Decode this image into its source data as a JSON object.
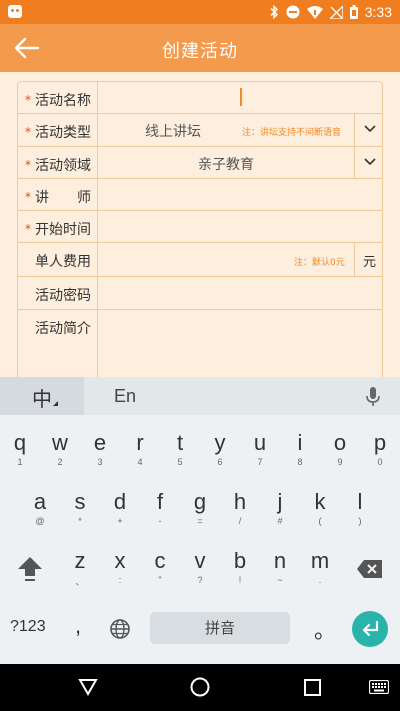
{
  "status_bar": {
    "time": "3:33"
  },
  "app_bar": {
    "title": "创建活动"
  },
  "form": {
    "required_mark": "*",
    "activity_name": {
      "label": "活动名称"
    },
    "activity_type": {
      "label": "活动类型",
      "value": "线上讲坛",
      "note": "注：讲坛支持不间断语音"
    },
    "activity_field": {
      "label": "活动领域",
      "value": "亲子教育"
    },
    "lecturer": {
      "label": "讲师"
    },
    "start_time": {
      "label": "开始时间"
    },
    "fee_per_person": {
      "label": "单人费用",
      "note": "注：默认0元",
      "unit": "元"
    },
    "activity_password": {
      "label": "活动密码"
    },
    "activity_intro": {
      "label": "活动简介"
    }
  },
  "keyboard": {
    "mode_zh": "中",
    "mode_en": "En",
    "row1": [
      {
        "k": "q",
        "s": "1"
      },
      {
        "k": "w",
        "s": "2"
      },
      {
        "k": "e",
        "s": "3"
      },
      {
        "k": "r",
        "s": "4"
      },
      {
        "k": "t",
        "s": "5"
      },
      {
        "k": "y",
        "s": "6"
      },
      {
        "k": "u",
        "s": "7"
      },
      {
        "k": "i",
        "s": "8"
      },
      {
        "k": "o",
        "s": "9"
      },
      {
        "k": "p",
        "s": "0"
      }
    ],
    "row2": [
      {
        "k": "a",
        "s": "@"
      },
      {
        "k": "s",
        "s": "*"
      },
      {
        "k": "d",
        "s": "+"
      },
      {
        "k": "f",
        "s": "-"
      },
      {
        "k": "g",
        "s": "="
      },
      {
        "k": "h",
        "s": "/"
      },
      {
        "k": "j",
        "s": "#"
      },
      {
        "k": "k",
        "s": "("
      },
      {
        "k": "l",
        "s": ")"
      }
    ],
    "row3": [
      {
        "k": "z",
        "s": "、"
      },
      {
        "k": "x",
        "s": ":"
      },
      {
        "k": "c",
        "s": "\""
      },
      {
        "k": "v",
        "s": "?"
      },
      {
        "k": "b",
        "s": "!"
      },
      {
        "k": "n",
        "s": "~"
      },
      {
        "k": "m",
        "s": "."
      }
    ],
    "symbols_label": "?123",
    "comma": ",",
    "space_label": "拼音",
    "period": "。"
  },
  "colors": {
    "status_bar": "#f07d1f",
    "app_bar": "#f39a4c",
    "accent_note": "#f08a2a",
    "required": "#e34b2b",
    "enter_key": "#2ab3ab"
  }
}
